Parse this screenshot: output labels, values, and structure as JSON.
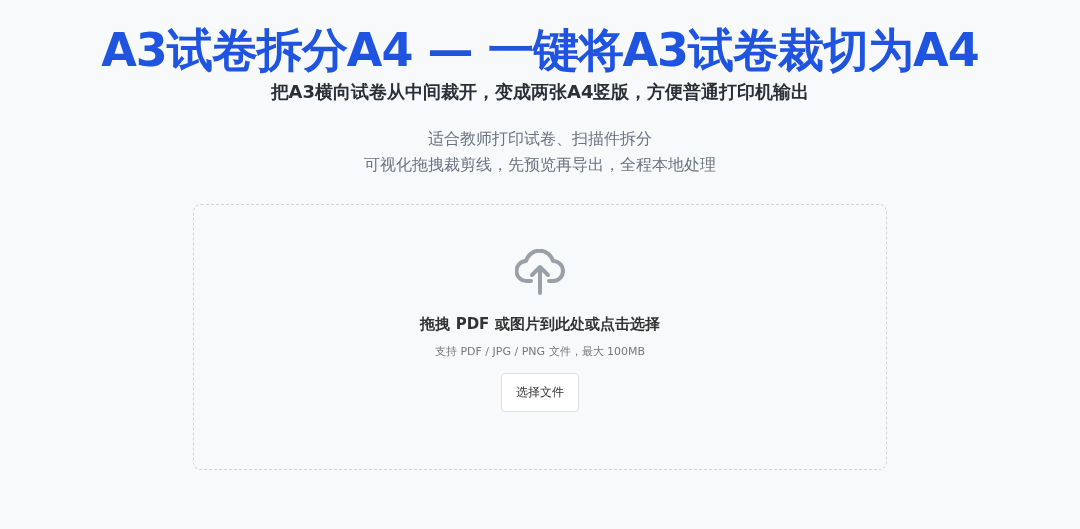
{
  "banner_title": "A3试卷拆分A4 — 一键将A3试卷裁切为A4",
  "subtitle": "把A3横向试卷从中间裁开，变成两张A4竖版，方便普通打印机输出",
  "description_lines": [
    "适合教师打印试卷、扫描件拆分",
    "可视化拖拽裁剪线，先预览再导出，全程本地处理"
  ],
  "dropzone": {
    "prompt": "拖拽 PDF 或图片到此处或点击选择",
    "hint": "支持 PDF / JPG / PNG 文件，最大 100MB",
    "button": "选择文件"
  }
}
